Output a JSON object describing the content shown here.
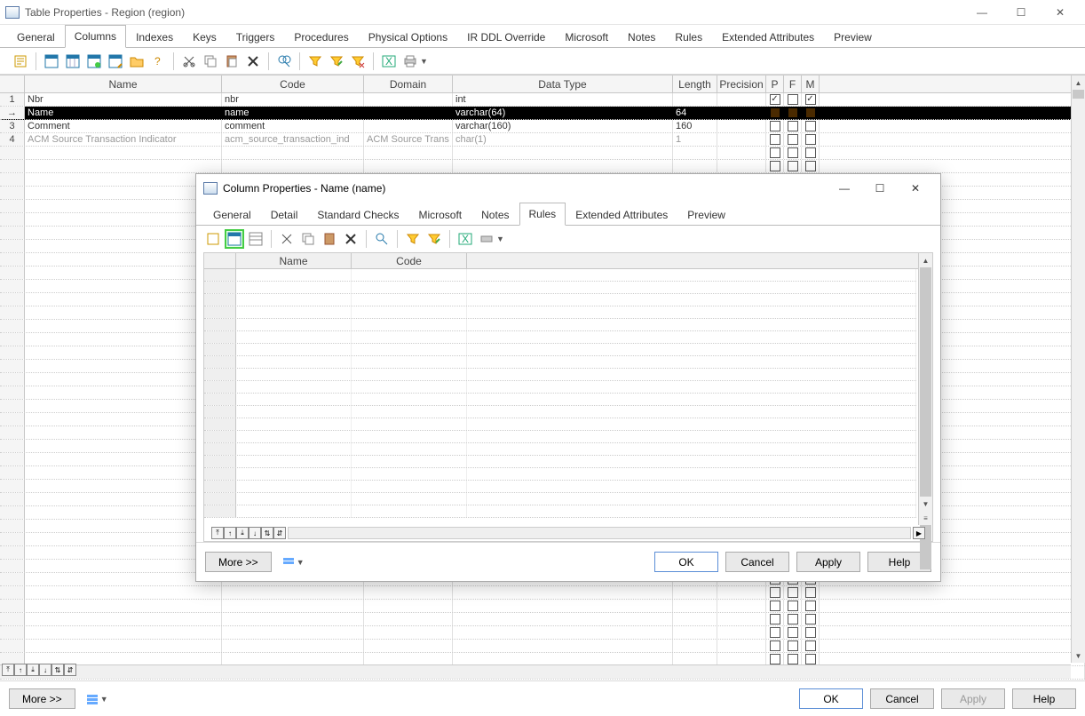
{
  "main": {
    "title": "Table Properties - Region (region)",
    "tabs": [
      "General",
      "Columns",
      "Indexes",
      "Keys",
      "Triggers",
      "Procedures",
      "Physical Options",
      "IR DDL Override",
      "Microsoft",
      "Notes",
      "Rules",
      "Extended Attributes",
      "Preview"
    ],
    "active_tab": "Columns",
    "headers": [
      "Name",
      "Code",
      "Domain",
      "Data Type",
      "Length",
      "Precision",
      "P",
      "F",
      "M"
    ],
    "rows": [
      {
        "n": "1",
        "name": "Nbr",
        "code": "nbr",
        "domain": "<None>",
        "dtype": "int",
        "len": "",
        "prec": "",
        "p": true,
        "f": false,
        "m": true,
        "sel": false,
        "dim": false
      },
      {
        "n": "→",
        "name": "Name",
        "code": "name",
        "domain": "<None>",
        "dtype": "varchar(64)",
        "len": "64",
        "prec": "",
        "p": false,
        "f": false,
        "m": false,
        "sel": true,
        "dim": false
      },
      {
        "n": "3",
        "name": "Comment",
        "code": "comment",
        "domain": "<None>",
        "dtype": "varchar(160)",
        "len": "160",
        "prec": "",
        "p": false,
        "f": false,
        "m": false,
        "sel": false,
        "dim": false
      },
      {
        "n": "4",
        "name": "ACM Source Transaction Indicator",
        "code": "acm_source_transaction_ind",
        "domain": "ACM Source Trans",
        "dtype": "char(1)",
        "len": "1",
        "prec": "",
        "p": false,
        "f": false,
        "m": false,
        "sel": false,
        "dim": true
      }
    ],
    "buttons": {
      "more": "More >>",
      "ok": "OK",
      "cancel": "Cancel",
      "apply": "Apply",
      "help": "Help"
    }
  },
  "dialog": {
    "title": "Column Properties - Name (name)",
    "tabs": [
      "General",
      "Detail",
      "Standard Checks",
      "Microsoft",
      "Notes",
      "Rules",
      "Extended Attributes",
      "Preview"
    ],
    "active_tab": "Rules",
    "headers": [
      "Name",
      "Code"
    ],
    "buttons": {
      "more": "More >>",
      "ok": "OK",
      "cancel": "Cancel",
      "apply": "Apply",
      "help": "Help"
    }
  },
  "icons": {
    "properties": "properties",
    "new-grid": "new-grid",
    "cut": "cut",
    "copy": "copy",
    "paste": "paste",
    "delete": "delete",
    "find": "find",
    "filter": "filter",
    "excel": "excel",
    "print": "print"
  }
}
